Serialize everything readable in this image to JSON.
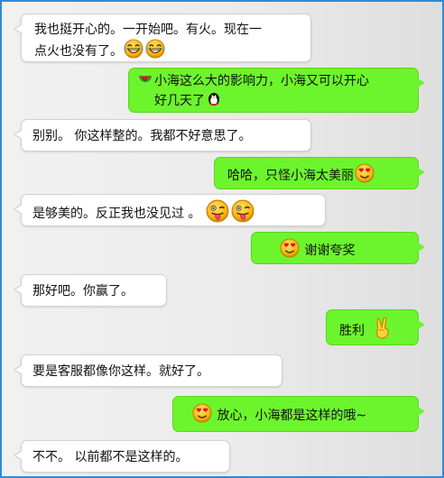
{
  "messages": [
    {
      "side": "left",
      "lines": [
        "我也挺开心的。一开始吧。有火。现在一",
        "点火也没有了。"
      ],
      "emojis_after": [
        "laughing-emoji",
        "laughing-emoji"
      ]
    },
    {
      "side": "right",
      "lines": [
        "小海这么大的影响力，小海又可以开心",
        "好几天了"
      ],
      "emoji_before": "watermelon-emoji",
      "emoji_after": "penguin-emoji"
    },
    {
      "side": "left",
      "text": "别别。 你这样整的。我都不好意思了。"
    },
    {
      "side": "right",
      "text": "哈哈，只怪小海太美丽",
      "emoji_after": "heart-eyes-emoji"
    },
    {
      "side": "left",
      "text": "是够美的。反正我也没见过 。",
      "emojis_after": [
        "tongue-emoji",
        "tongue-emoji"
      ]
    },
    {
      "side": "right",
      "text": "谢谢夸奖",
      "emoji_before": "heart-eyes-emoji"
    },
    {
      "side": "left",
      "text": "那好吧。你赢了。"
    },
    {
      "side": "right",
      "text": "胜利",
      "emoji_after": "victory-hand-emoji"
    },
    {
      "side": "left",
      "text": "要是客服都像你这样。就好了。"
    },
    {
      "side": "right",
      "text": "放心，小海都是这样的哦~",
      "emoji_before": "heart-eyes-emoji"
    },
    {
      "side": "left",
      "text": "不不。 以前都不是这样的。"
    }
  ],
  "colors": {
    "frame_border": "#2f8ad8",
    "sent_bubble": "#6cf52d",
    "received_bubble": "#ffffff",
    "emoji_face": "#f6b913"
  }
}
